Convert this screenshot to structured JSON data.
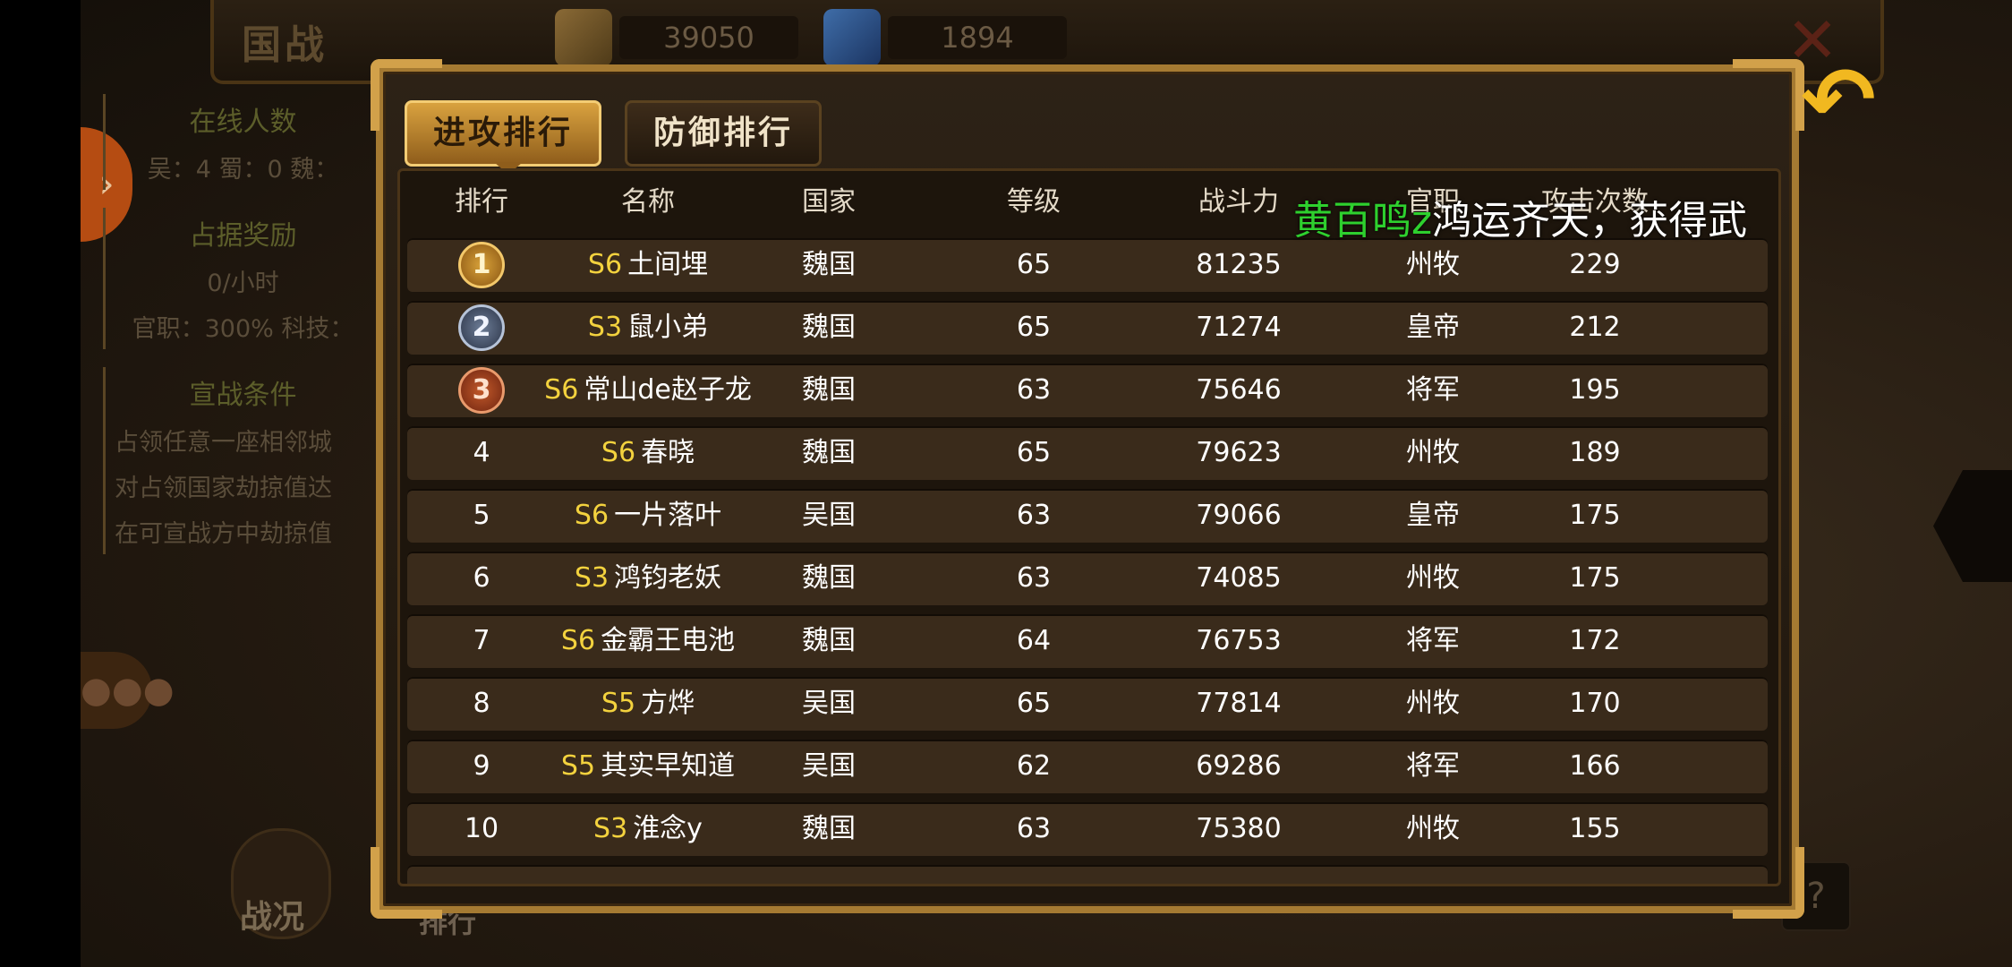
{
  "header": {
    "title": "国战",
    "resources": [
      {
        "icon": "scroll-icon",
        "value": "39050"
      },
      {
        "icon": "gem-icon",
        "value": "1894"
      }
    ]
  },
  "left_panel": {
    "online_title": "在线人数",
    "online_counts": "吴：4 蜀：0 魏：",
    "occupy_title": "占据奖励",
    "occupy_rate": "0/小时",
    "occupy_bonus": "官职：300% 科技：",
    "declare_title": "宣战条件",
    "declare_lines": [
      "占领任意一座相邻城",
      "对占领国家劫掠值达",
      "在可宣战方中劫掠值"
    ]
  },
  "bottom_labels": {
    "battle": "战况",
    "rank": "排行"
  },
  "help": "?",
  "tabs": {
    "attack": "进攻排行",
    "defense": "防御排行"
  },
  "columns": [
    "排行",
    "名称",
    "国家",
    "等级",
    "战斗力",
    "官职",
    "攻击次数"
  ],
  "rows": [
    {
      "rank": "1",
      "server": "S6",
      "name": "土间埋",
      "country": "魏国",
      "level": "65",
      "power": "81235",
      "title": "州牧",
      "attacks": "229"
    },
    {
      "rank": "2",
      "server": "S3",
      "name": "鼠小弟",
      "country": "魏国",
      "level": "65",
      "power": "71274",
      "title": "皇帝",
      "attacks": "212"
    },
    {
      "rank": "3",
      "server": "S6",
      "name": "常山de赵子龙",
      "country": "魏国",
      "level": "63",
      "power": "75646",
      "title": "将军",
      "attacks": "195"
    },
    {
      "rank": "4",
      "server": "S6",
      "name": "春晓",
      "country": "魏国",
      "level": "65",
      "power": "79623",
      "title": "州牧",
      "attacks": "189"
    },
    {
      "rank": "5",
      "server": "S6",
      "name": "一片落叶",
      "country": "吴国",
      "level": "63",
      "power": "79066",
      "title": "皇帝",
      "attacks": "175"
    },
    {
      "rank": "6",
      "server": "S3",
      "name": "鸿钧老妖",
      "country": "魏国",
      "level": "63",
      "power": "74085",
      "title": "州牧",
      "attacks": "175"
    },
    {
      "rank": "7",
      "server": "S6",
      "name": "金霸王电池",
      "country": "魏国",
      "level": "64",
      "power": "76753",
      "title": "将军",
      "attacks": "172"
    },
    {
      "rank": "8",
      "server": "S5",
      "name": "方烨",
      "country": "吴国",
      "level": "65",
      "power": "77814",
      "title": "州牧",
      "attacks": "170"
    },
    {
      "rank": "9",
      "server": "S5",
      "name": "其实早知道",
      "country": "吴国",
      "level": "62",
      "power": "69286",
      "title": "将军",
      "attacks": "166"
    },
    {
      "rank": "10",
      "server": "S3",
      "name": "淮念y",
      "country": "魏国",
      "level": "63",
      "power": "75380",
      "title": "州牧",
      "attacks": "155"
    }
  ],
  "broadcast": {
    "name": "黄百鸣z",
    "message": "鸿运齐天，获得武"
  },
  "colors": {
    "server_tag": "#f3d23e",
    "broadcast_name": "#2ed02e",
    "frame": "#a57a32"
  }
}
